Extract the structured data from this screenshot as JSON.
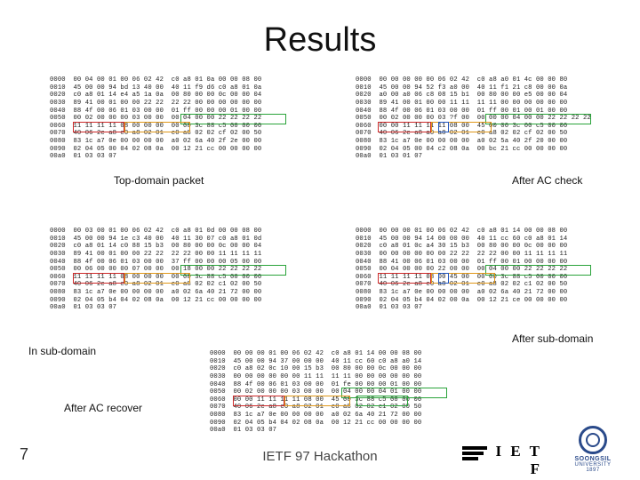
{
  "title": "Results",
  "slide_number": "7",
  "footer": "IETF 97 Hackathon",
  "labels": {
    "top_domain": "Top-domain packet",
    "after_ac_check": "After AC check",
    "in_sub": "In sub-domain",
    "after_sub": "After sub-domain",
    "after_recover": "After AC recover"
  },
  "logos": {
    "ietf": "I E T F",
    "ssu_line1": "SOONGSIL",
    "ssu_line2": "UNIVERSITY",
    "ssu_year": "1897"
  },
  "hex": {
    "h1": "0000  00 04 00 01 00 06 02 42  c0 a8 01 0a 00 00 08 00\n0010  45 00 00 94 bd 13 40 00  40 11 f9 d6 c0 a8 01 0a\n0020  c0 a8 01 14 e4 a5 1a 0a  00 80 00 00 0c 00 00 04\n0030  89 41 00 01 00 00 22 22  22 22 00 00 00 00 00 00\n0040  88 4f 00 06 01 03 00 00  01 ff 00 00 00 01 00 00\n0050  00 02 00 00 00 03 00 00  00 04 00 00 22 22 22 22\n0060  11 11 11 11 08 00 00 00  00 00 3c 88 c5 00 00 00\n0070  40 06 2c a8 c0 a8 02 01  c0 a8 02 02 cf 02 00 50\n0080  83 1c a7 0e 00 00 00 00  a0 02 6a 40 2f 2e 00 00\n0090  02 04 05 00 04 02 08 0a  00 12 21 cc 00 00 00 00\n00a0  01 03 03 07",
    "h2": "0000  00 00 00 00 00 06 02 42  c0 a8 a0 01 4c 00 00 80\n0010  45 00 00 94 52 f3 a0 00  40 11 f1 21 c8 00 00 0a\n0020  a0 00 a0 06 c8 08 15 b1  00 80 00 00 e5 00 00 04\n0030  89 41 00 01 00 00 11 11  11 11 00 00 00 00 00 00\n0040  88 4f 00 06 01 03 00 00  01 ff 00 01 00 01 00 00\n0050  00 02 00 00 00 03 ?f 00  00 00 00 04 00 00 22 22 22 22\n0060  00 00 11 11 11 11 08 00  45 00 00 3c 00 c5 00 00\n0070  40 06 2c a8 a0 a8 02 01  c0 a8 02 02 cf 02 00 50\n0080  83 1c a7 0e 00 00 00 00  a0 02 5a 40 2f 20 00 00\n0090  02 04 05 00 04 c2 08 0a  00 bc 21 cc 00 00 00 00\n00a0  01 03 01 07",
    "h3": "0000  00 03 00 01 00 06 02 42  c0 a8 01 0d 00 00 08 00\n0010  45 00 00 94 1e c3 40 00  40 11 30 07 c0 a8 01 0d\n0020  c0 a8 01 14 c0 88 15 b3  00 80 00 00 0c 00 00 04\n0030  89 41 00 01 00 00 22 22  22 22 00 00 11 11 11 11\n0040  88 4f 00 06 01 03 00 00  37 ff 00 00 00 05 00 00\n0050  00 06 00 00 00 07 00 00  00 18 00 00 22 22 22 22\n0060  11 11 11 11 08 00 00 00  00 00 3c 88 c5 00 00 00\n0070  40 06 2c a8 c0 a8 02 01  c0 a8 02 02 c1 02 00 50\n0080  83 1c a7 0e 00 00 00 00  a0 02 6a 40 21 72 00 00\n0090  02 04 05 b4 04 02 08 0a  00 12 21 cc 00 00 00 00\n00a0  01 03 03 07",
    "h4": "0000  00 00 00 01 00 06 02 42  c0 a8 01 14 00 00 08 00\n0010  45 00 00 94 14 00 00 00  40 11 cc 60 c0 a8 01 14\n0020  c0 a8 01 0c a4 30 15 b3  00 80 00 00 0c 00 00 00\n0030  00 00 00 00 00 00 22 22  22 22 00 00 11 11 11 11\n0040  88 41 00 06 01 03 00 00  01 ff 00 01 00 00 00 00\n0050  00 04 00 00 00 22 00 00  00 04 00 00 22 22 22 22\n0060  11 11 11 11 08 00 45 00  00 00 3c 88 c5 00 00 00\n0070  40 06 2c a8 c0 a8 02 01  c0 a8 02 02 c1 02 00 50\n0080  83 1c a7 0e 00 00 00 00  a0 02 6a 40 21 72 00 00\n0090  02 04 05 b4 04 02 00 0a  00 12 21 ce 00 00 00 00\n00a0  01 03 03 07",
    "h5": "0000  00 00 00 01 00 06 02 42  c0 a8 01 14 00 00 08 00\n0010  45 00 00 94 37 00 00 00  40 11 cc 60 c0 a8 a0 14\n0020  c0 a8 02 0c 10 00 15 b3  00 80 00 00 0c 00 00 00\n0030  00 00 00 00 00 00 11 11  11 11 00 00 00 00 00 00\n0040  88 4f 00 06 01 03 00 00  01 fe 00 00 00 01 00 00\n0050  00 02 00 00 00 03 00 00  00 04 00 00 04 01 00 00\n0060  00 00 11 11 11 11 08 00  45 00 3c 88 c5 00 00 00\n0070  40 06 2c a8 c0 a8 02 01  c0 a8 02 02 c1 02 00 50\n0080  83 1c a7 0e 00 00 00 00  a0 02 6a 40 21 72 00 00\n0090  02 04 05 b4 04 02 08 0a  00 12 21 cc 00 00 00 00\n00a0  01 03 03 07"
  },
  "colors": {
    "red": "#cc2a2a",
    "green": "#2aa33a",
    "orange": "#e0981a",
    "blue": "#2255bb"
  }
}
